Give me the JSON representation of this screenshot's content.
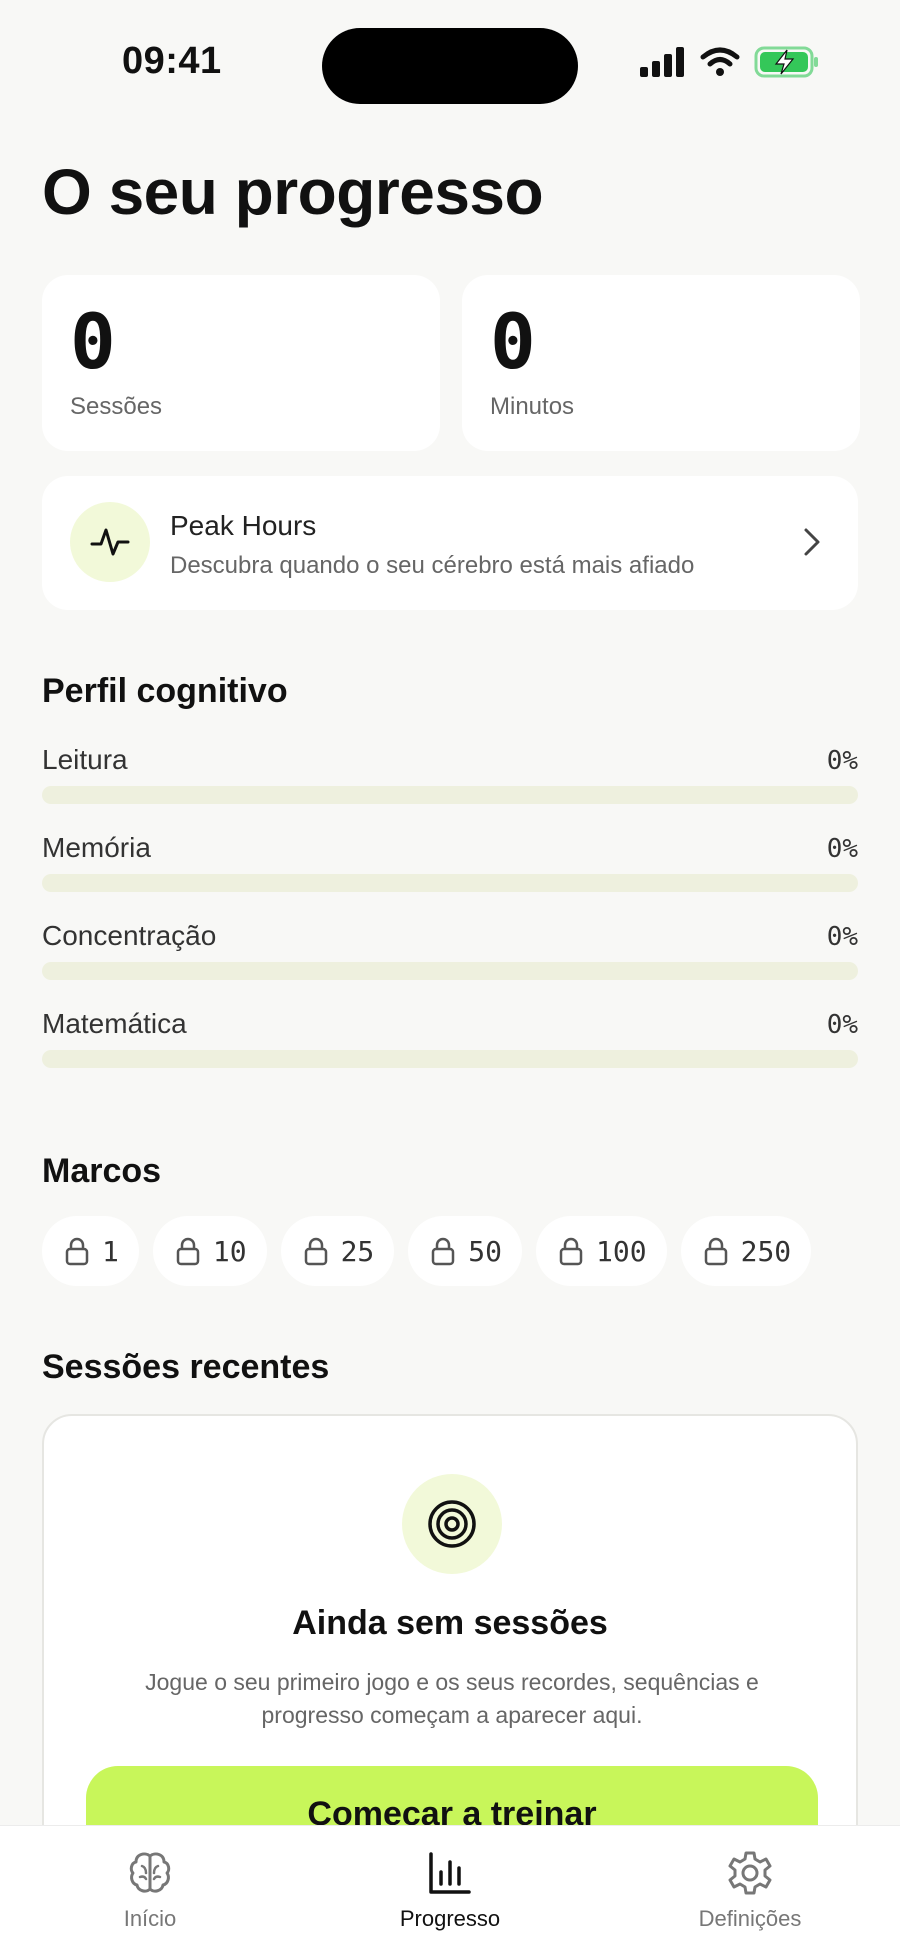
{
  "status_bar": {
    "time": "09:41"
  },
  "header": {
    "title": "O seu progresso"
  },
  "stats": [
    {
      "value": "0",
      "label": "Sessões"
    },
    {
      "value": "0",
      "label": "Minutos"
    }
  ],
  "peak_hours": {
    "title": "Peak Hours",
    "subtitle": "Descubra quando o seu cérebro está mais afiado"
  },
  "cognitive_profile": {
    "title": "Perfil cognitivo",
    "skills": [
      {
        "name": "Leitura",
        "percent_label": "0%",
        "level": 0
      },
      {
        "name": "Memória",
        "percent_label": "0%",
        "level": 0
      },
      {
        "name": "Concentração",
        "percent_label": "0%",
        "level": 0
      },
      {
        "name": "Matemática",
        "percent_label": "0%",
        "level": 0
      }
    ]
  },
  "milestones": {
    "title": "Marcos",
    "items": [
      "1",
      "10",
      "25",
      "50",
      "100",
      "250"
    ]
  },
  "recent_sessions": {
    "title": "Sessões recentes",
    "empty_title": "Ainda sem sessões",
    "empty_description": "Jogue o seu primeiro jogo e os seus recordes, sequências e progresso começam a aparecer aqui.",
    "cta_label": "Começar a treinar"
  },
  "tab_bar": {
    "tabs": [
      {
        "label": "Início",
        "icon": "brain-icon",
        "active": false
      },
      {
        "label": "Progresso",
        "icon": "bar-chart-icon",
        "active": true
      },
      {
        "label": "Definições",
        "icon": "gear-icon",
        "active": false
      }
    ]
  },
  "colors": {
    "accent": "#c8f65a",
    "accent_soft": "#f2f9d9",
    "background": "#f8f8f6",
    "battery": "#34c759"
  }
}
